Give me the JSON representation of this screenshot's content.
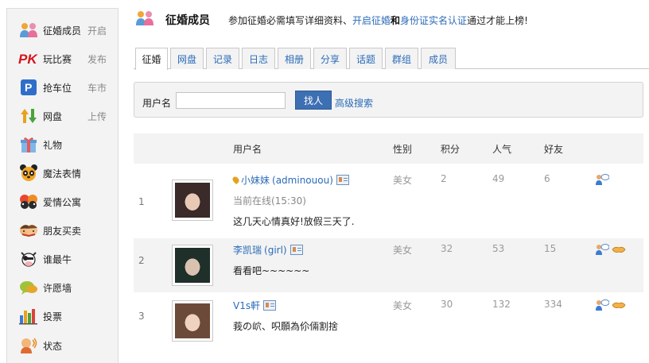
{
  "sidebar": {
    "items": [
      {
        "icon": "couple-icon",
        "label": "征婚成员",
        "action": "开启"
      },
      {
        "icon": "pk-icon",
        "label": "玩比赛",
        "action": "发布"
      },
      {
        "icon": "parking-icon",
        "label": "抢车位",
        "action": "车市"
      },
      {
        "icon": "netdisk-icon",
        "label": "网盘",
        "action": "上传"
      },
      {
        "icon": "gift-icon",
        "label": "礼物",
        "action": ""
      },
      {
        "icon": "panda-icon",
        "label": "魔法表情",
        "action": ""
      },
      {
        "icon": "love-apartment-icon",
        "label": "爱情公寓",
        "action": ""
      },
      {
        "icon": "friends-trade-icon",
        "label": "朋友买卖",
        "action": ""
      },
      {
        "icon": "cow-icon",
        "label": "谁最牛",
        "action": ""
      },
      {
        "icon": "wish-wall-icon",
        "label": "许愿墙",
        "action": ""
      },
      {
        "icon": "vote-icon",
        "label": "投票",
        "action": ""
      },
      {
        "icon": "status-icon",
        "label": "状态",
        "action": ""
      }
    ]
  },
  "header": {
    "title": "征婚成员",
    "notice_prefix": "参加征婚必需填写详细资料、",
    "notice_link1": "开启征婚",
    "notice_and": "和",
    "notice_link2": "身份证实名认证",
    "notice_suffix": "通过才能上榜!"
  },
  "tabs": [
    "征婚",
    "网盘",
    "记录",
    "日志",
    "相册",
    "分享",
    "话题",
    "群组",
    "成员"
  ],
  "search": {
    "label": "用户名",
    "value": "",
    "button": "找人",
    "advanced": "高级搜索"
  },
  "table": {
    "headers": {
      "username": "用户名",
      "gender": "性别",
      "points": "积分",
      "popularity": "人气",
      "friends": "好友"
    },
    "rows": [
      {
        "index": "1",
        "name": "小妹妹",
        "uid": "(adminouou)",
        "online": "当前在线(15:30)",
        "message": "这几天心情真好!放假三天了.",
        "gender": "美女",
        "points": "2",
        "popularity": "49",
        "friends": "6",
        "avatar_colors": [
          "#3a2a2a",
          "#e8c9b5"
        ]
      },
      {
        "index": "2",
        "name": "李凯瑞",
        "uid": "(girl)",
        "online": "",
        "message": "看看吧~~~~~~",
        "gender": "美女",
        "points": "32",
        "popularity": "53",
        "friends": "15",
        "avatar_colors": [
          "#1f2f2a",
          "#d9c2b0"
        ]
      },
      {
        "index": "3",
        "name": "V1s軒",
        "uid": "",
        "online": "",
        "message": "莪の岤、呮願為伱倆割捨",
        "gender": "美女",
        "points": "30",
        "popularity": "132",
        "friends": "334",
        "avatar_colors": [
          "#6b4a3a",
          "#f0d2c0"
        ]
      }
    ]
  }
}
